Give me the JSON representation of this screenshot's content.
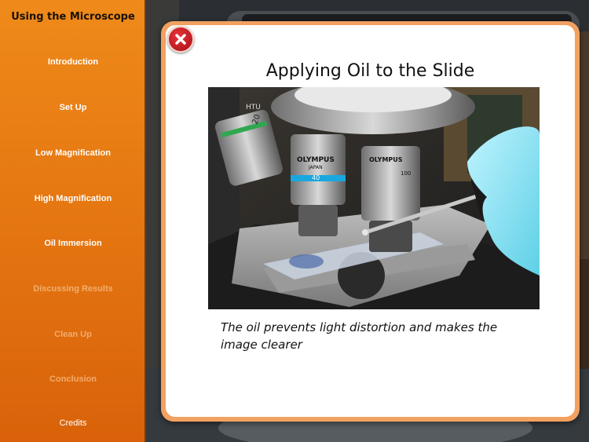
{
  "sidebar": {
    "title": "Using the Microscope",
    "items": [
      {
        "label": "Introduction",
        "enabled": true
      },
      {
        "label": "Set Up",
        "enabled": true
      },
      {
        "label": "Low Magnification",
        "enabled": true
      },
      {
        "label": "High Magnification",
        "enabled": true
      },
      {
        "label": "Oil Immersion",
        "enabled": true
      },
      {
        "label": "Discussing Results",
        "enabled": false
      },
      {
        "label": "Clean Up",
        "enabled": false
      },
      {
        "label": "Conclusion",
        "enabled": false
      },
      {
        "label": "Credits",
        "enabled": true
      }
    ]
  },
  "modal": {
    "title": "Applying Oil to the Slide",
    "caption": "The oil prevents light distortion and makes the image clearer",
    "photo": {
      "objective_left_brand": "OLYMPUS",
      "objective_left_sub": "JAPAN",
      "objective_left_mag": "40",
      "objective_right_brand": "OLYMPUS",
      "objective_right_mag": "100",
      "objective_back_mag": "20",
      "brand_text": "HTU"
    }
  },
  "colors": {
    "sidebar_top": "#ee8a1a",
    "sidebar_bottom": "#d9620a",
    "modal_border": "#f2a160",
    "close_button": "#c8202a"
  }
}
